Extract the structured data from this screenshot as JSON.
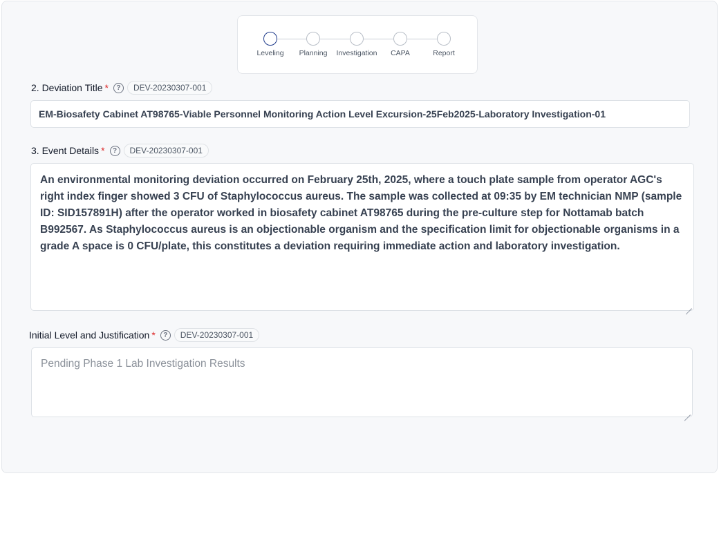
{
  "stepper": {
    "steps": [
      {
        "label": "Leveling",
        "active": true
      },
      {
        "label": "Planning",
        "active": false
      },
      {
        "label": "Investigation",
        "active": false
      },
      {
        "label": "CAPA",
        "active": false
      },
      {
        "label": "Report",
        "active": false
      }
    ]
  },
  "deviation_title": {
    "label": "2. Deviation Title",
    "required_mark": "*",
    "help_icon": "question-circle-icon",
    "tag": "DEV-20230307-001",
    "value": "EM-Biosafety Cabinet AT98765-Viable Personnel Monitoring Action Level Excursion-25Feb2025-Laboratory Investigation-01"
  },
  "event_details": {
    "label": "3. Event Details",
    "required_mark": "*",
    "help_icon": "question-circle-icon",
    "tag": "DEV-20230307-001",
    "value": "An environmental monitoring deviation occurred on February 25th, 2025, where a touch plate sample from operator AGC's right index finger showed 3 CFU of Staphylococcus aureus. The sample was collected at 09:35 by EM technician NMP (sample ID: SID157891H) after the operator worked in biosafety cabinet AT98765 during the pre-culture step for Nottamab batch B992567. As Staphylococcus aureus is an objectionable organism and the specification limit for objectionable organisms in a grade A space is 0 CFU/plate, this constitutes a deviation requiring immediate action and laboratory investigation."
  },
  "initial_level": {
    "label": "Initial Level and Justification",
    "required_mark": "*",
    "help_icon": "question-circle-icon",
    "tag": "DEV-20230307-001",
    "placeholder": "Pending Phase 1 Lab Investigation Results",
    "value": ""
  },
  "colors": {
    "active_step": "#1e3a8a",
    "required": "#dc2626",
    "panel_bg": "#f7f8fa"
  }
}
